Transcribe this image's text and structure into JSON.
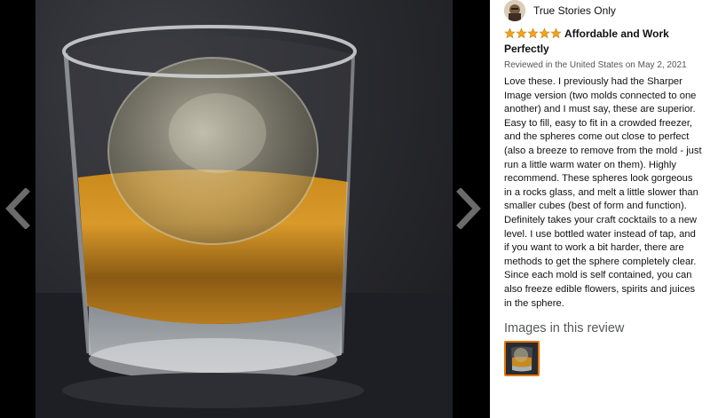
{
  "reviewer": {
    "name": "True Stories Only"
  },
  "review": {
    "rating": 5,
    "max_rating": 5,
    "title": "Affordable and Work Perfectly",
    "meta": "Reviewed in the United States on May 2, 2021",
    "body": "Love these. I previously had the Sharper Image version (two molds connected to one another) and I must say, these are superior. Easy to fill, easy to fit in a crowded freezer, and the spheres come out close to perfect (also a breeze to remove from the mold - just run a little warm water on them). Highly recommend. These spheres look gorgeous in a rocks glass, and melt a little slower than smaller cubes (best of form and function). Definitely takes your craft cocktails to a new level. I use bottled water instead of tap, and if you want to work a bit harder, there are methods to get the sphere completely clear. Since each mold is self contained, you can also freeze edible flowers, spirits and juices in the sphere."
  },
  "images_section": {
    "heading": "Images in this review",
    "thumbnail_count": 1
  },
  "viewer": {
    "prev_icon": "chevron-left-icon",
    "next_icon": "chevron-right-icon"
  },
  "colors": {
    "star": "#f0a41c",
    "thumb_border": "#e77600",
    "viewer_bg": "#000000"
  }
}
